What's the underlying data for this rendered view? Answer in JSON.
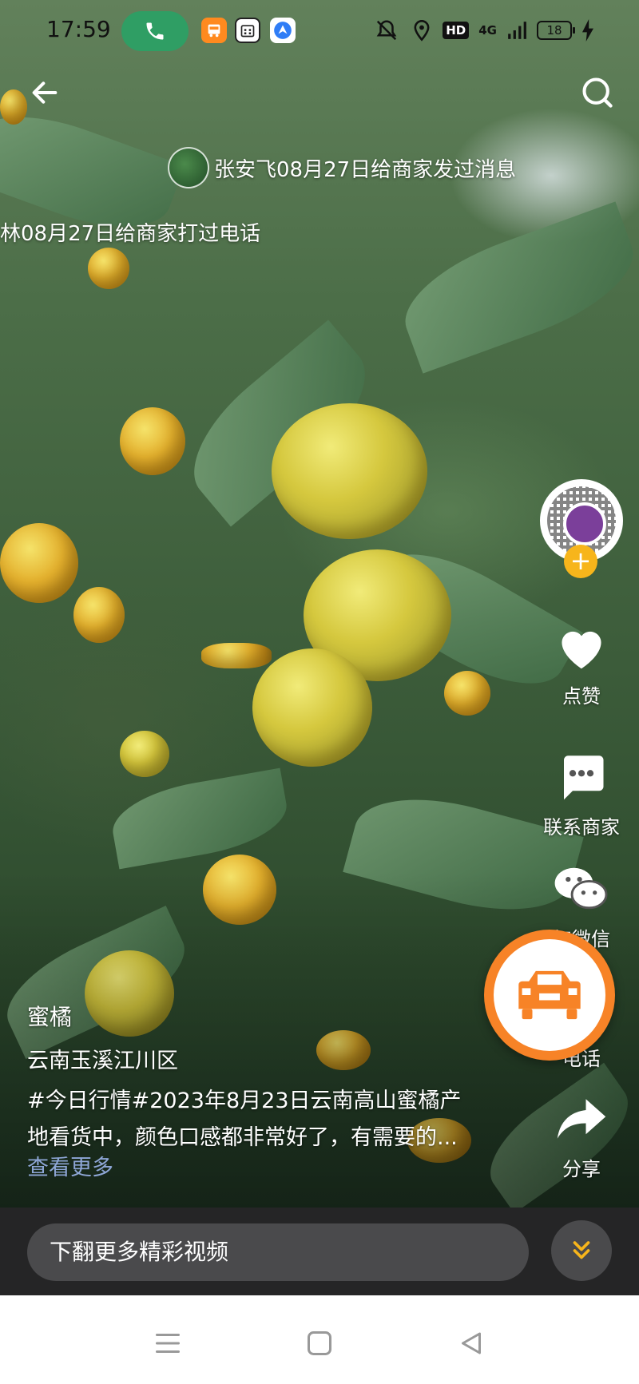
{
  "status_bar": {
    "time": "17:59",
    "battery": "18",
    "network": "4G",
    "hd": "HD"
  },
  "notices": {
    "message_notice": "张安飞08月27日给商家发过消息",
    "call_notice": "林08月27日给商家打过电话"
  },
  "actions": {
    "like": "点赞",
    "contact": "联系商家",
    "wechat": "加微信",
    "call": "电话",
    "share": "分享"
  },
  "caption": {
    "title": "蜜橘",
    "location": "云南玉溪江川区",
    "desc_line1": "#今日行情#2023年8月23日云南高山蜜橘产",
    "desc_line2": "地看货中，颜色口感都非常好了，有需要的...",
    "more": "查看更多"
  },
  "bottom": {
    "more_videos": "下翻更多精彩视频"
  },
  "icons": {
    "back": "arrow-left-icon",
    "search": "search-icon",
    "like": "heart-icon",
    "contact": "chat-bubble-icon",
    "wechat": "wechat-icon",
    "share": "share-arrow-icon",
    "fab": "truck-icon",
    "scroll_down": "double-chevron-down-icon"
  },
  "colors": {
    "fab": "#f78327",
    "follow": "#f7b51b",
    "link": "#8ea6d6",
    "call_pill": "#2f9e64"
  }
}
